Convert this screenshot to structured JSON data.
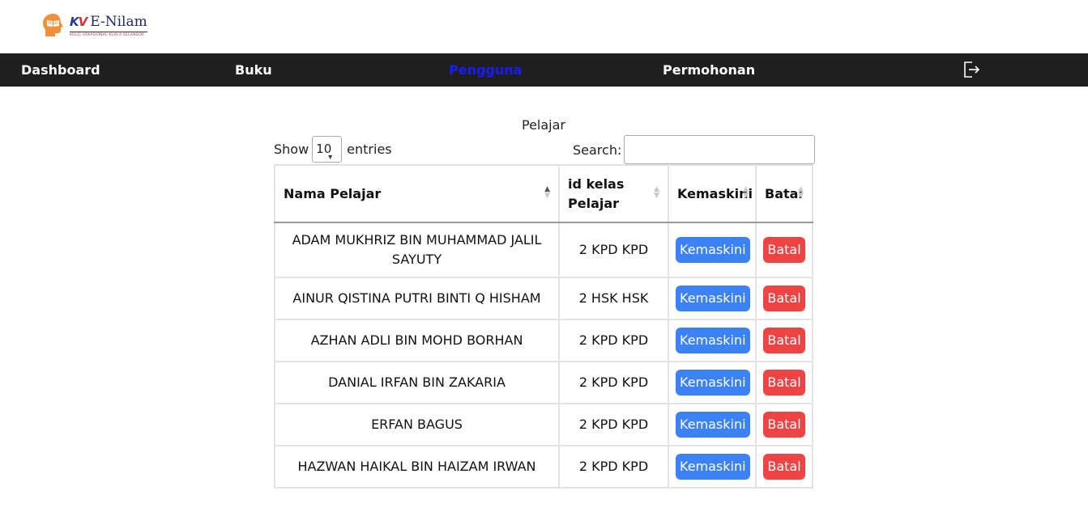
{
  "logo": {
    "mark": "KV",
    "title": "E-Nilam",
    "subtitle": "KOLEJ VOKASIONAL KUALA SELANGOR"
  },
  "nav": {
    "items": [
      {
        "label": "Dashboard"
      },
      {
        "label": "Buku"
      },
      {
        "label": "Pengguna"
      },
      {
        "label": "Permohonan"
      }
    ],
    "active": "Pengguna"
  },
  "table": {
    "caption": "Pelajar",
    "show_label": "Show",
    "entries_value": "10",
    "entries_label": "entries",
    "search_label": "Search:",
    "search_value": "",
    "headers": [
      "Nama Pelajar",
      "id kelas Pelajar",
      "Kemaskini",
      "Batal"
    ],
    "rows": [
      {
        "name": "ADAM MUKHRIZ BIN MUHAMMAD JALIL SAYUTY",
        "kelas": "2 KPD KPD",
        "edit": "Kemaskini",
        "del": "Batal"
      },
      {
        "name": "AINUR QISTINA PUTRI BINTI Q HISHAM",
        "kelas": "2 HSK HSK",
        "edit": "Kemaskini",
        "del": "Batal"
      },
      {
        "name": "AZHAN ADLI BIN MOHD BORHAN",
        "kelas": "2 KPD KPD",
        "edit": "Kemaskini",
        "del": "Batal"
      },
      {
        "name": "DANIAL IRFAN BIN ZAKARIA",
        "kelas": "2 KPD KPD",
        "edit": "Kemaskini",
        "del": "Batal"
      },
      {
        "name": "ERFAN BAGUS",
        "kelas": "2 KPD KPD",
        "edit": "Kemaskini",
        "del": "Batal"
      },
      {
        "name": "HAZWAN HAIKAL BIN HAIZAM IRWAN",
        "kelas": "2 KPD KPD",
        "edit": "Kemaskini",
        "del": "Batal"
      },
      {
        "name": "",
        "kelas": "",
        "edit": "",
        "del": ""
      }
    ]
  },
  "colors": {
    "nav_bg": "#1f1f1f",
    "nav_active": "#1a1aff",
    "button_blue": "#3b82f6",
    "button_red": "#ef4444"
  },
  "icons": {
    "logo": "head-book-icon",
    "logout": "logout-icon"
  }
}
